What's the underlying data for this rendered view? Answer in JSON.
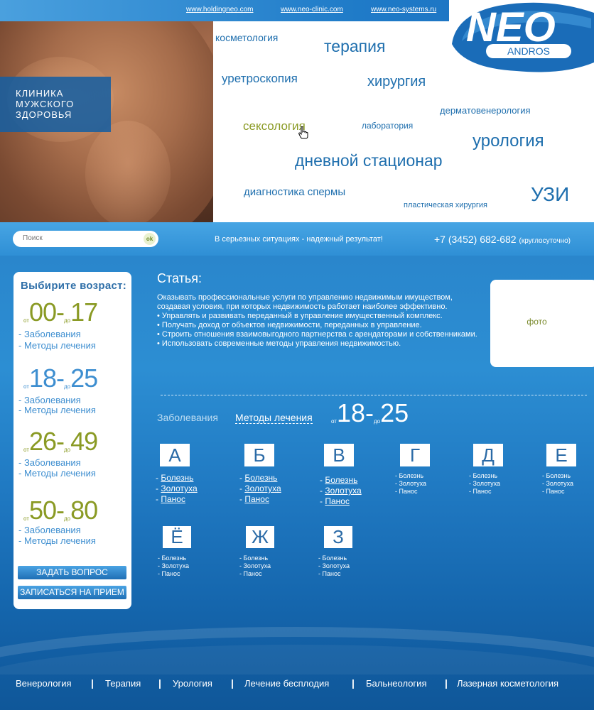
{
  "header": {
    "links": [
      "www.holdingneo.com",
      "www.neo-clinic.com",
      "www.neo-systems.ru"
    ],
    "clinic_lines": [
      "КЛИНИКА",
      "МУЖСКОГО",
      "ЗДОРОВЬЯ"
    ],
    "logo_main": "NEO",
    "logo_sub": "ANDROS",
    "services": [
      "косметология",
      "терапия",
      "уретроскопия",
      "хирургия",
      "дерматовенерология",
      "сексология",
      "лаборатория",
      "урология",
      "дневной стационар",
      "диагностика спермы",
      "УЗИ",
      "пластическая хирургия"
    ]
  },
  "search": {
    "placeholder": "Поиск",
    "ok_label": "ok"
  },
  "slogan": "В серьезных ситуациях -  надежный результат!",
  "phone": {
    "number": "+7 (3452) 682-682",
    "note": "(круглосуточно)"
  },
  "sidebar": {
    "title": "Выбирите возраст:",
    "ages": [
      {
        "from_label": "от",
        "from": "00",
        "to_label": "до",
        "to": "17",
        "color": "#8a9a24"
      },
      {
        "from_label": "от",
        "from": "18",
        "to_label": "до",
        "to": "25",
        "color": "#3d8ed0"
      },
      {
        "from_label": "от",
        "from": "26",
        "to_label": "до",
        "to": "49",
        "color": "#8a9a24"
      },
      {
        "from_label": "от",
        "from": "50",
        "to_label": "до",
        "to": "80",
        "color": "#8a9a24"
      }
    ],
    "link_diseases": "- Заболевания",
    "link_methods": "- Методы лечения",
    "btn_question": "ЗАДАТЬ ВОПРОС",
    "btn_appointment": "ЗАПИСАТЬСЯ  НА ПРИЕМ"
  },
  "article": {
    "title": "Статья:",
    "intro": "Оказывать профессиональные услуги по управлению недвижимым имуществом, создавая условия, при которых недвижимость работает наиболее эффективно.",
    "bullets": [
      "• Управлять и развивать переданный в управление имущественный комплекс.",
      "• Получать доход от объектов недвижимости, переданных в управление.",
      "• Строить отношения взаимовыгодного партнерства с арендаторами и собственниками.",
      "• Использовать современные методы управления недвижимостью."
    ],
    "photo_label": "фото"
  },
  "tabs": {
    "diseases": "Заболевания",
    "methods": "Методы лечения",
    "range": {
      "from_label": "от",
      "from": "18",
      "to_label": "до",
      "to": "25"
    }
  },
  "letters": [
    "А",
    "Б",
    "В",
    "Г",
    "Д",
    "Е",
    "Ё",
    "Ж",
    "З"
  ],
  "letter_links": [
    "Болезнь",
    "Золотуха",
    "Панос"
  ],
  "bottom_nav": [
    "Венерология",
    "Терапия",
    "Урология",
    "Лечение бесплодия",
    "Бальнеология",
    "Лазерная косметология"
  ],
  "colors": {
    "accent_blue": "#1f6fae",
    "olive": "#8a9a24",
    "highlight_service": "#8a9a24"
  }
}
